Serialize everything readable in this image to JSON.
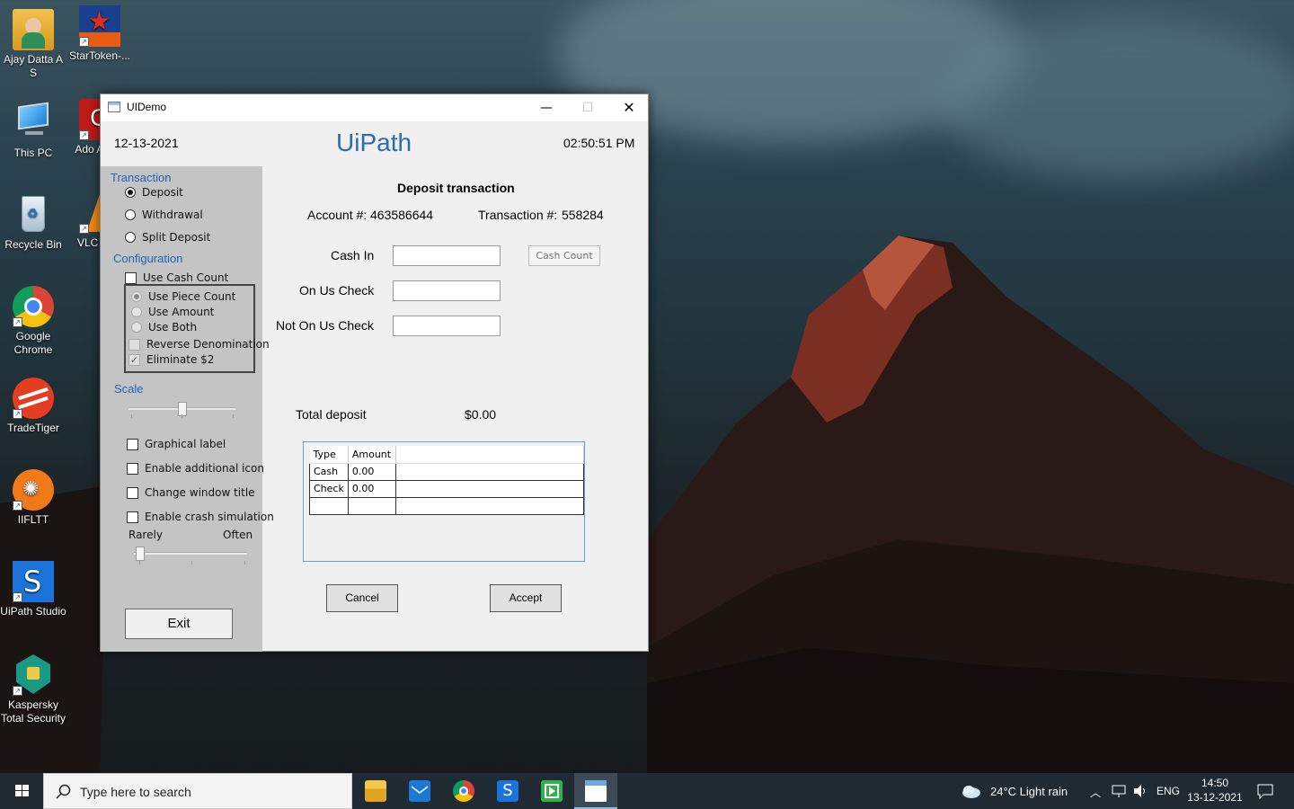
{
  "desktop": {
    "icons": [
      {
        "label": "Ajay Datta A S"
      },
      {
        "label": "StarToken-..."
      },
      {
        "label": "This PC"
      },
      {
        "label": "Ado Acrob"
      },
      {
        "label": "Recycle Bin"
      },
      {
        "label": "VLC r pla"
      },
      {
        "label": "Google Chrome"
      },
      {
        "label": "TradeTiger"
      },
      {
        "label": "IIFLTT"
      },
      {
        "label": "UiPath Studio"
      },
      {
        "label": "Kaspersky Total Security"
      }
    ]
  },
  "window": {
    "title": "UIDemo",
    "controls": {
      "minimize": "—",
      "maximize": "☐",
      "close": "✕"
    },
    "header": {
      "date": "12-13-2021",
      "brand": "UiPath",
      "time": "02:50:51 PM"
    },
    "left": {
      "transaction_label": "Transaction",
      "transaction_options": [
        "Deposit",
        "Withdrawal",
        "Split Deposit"
      ],
      "transaction_selected": "Deposit",
      "configuration_label": "Configuration",
      "use_cash_count": "Use Cash Count",
      "cash_count_options": [
        "Use Piece Count",
        "Use Amount",
        "Use Both"
      ],
      "reverse_denomination": "Reverse Denomination",
      "eliminate_2": "Eliminate $2",
      "eliminate_2_checked": true,
      "scale_label": "Scale",
      "scale_value": 0.5,
      "graphical_label": "Graphical label",
      "enable_additional_icon": "Enable additional icon",
      "change_window_title": "Change window title",
      "enable_crash_simulation": "Enable crash simulation",
      "rarely": "Rarely",
      "often": "Often",
      "crash_value": 0.0,
      "exit": "Exit"
    },
    "main": {
      "title": "Deposit transaction",
      "account_label": "Account #:",
      "account_value": "463586644",
      "transaction_label": "Transaction #:",
      "transaction_value": "558284",
      "cash_in": "Cash In",
      "on_us_check": "On Us Check",
      "not_on_us_check": "Not On Us Check",
      "cash_count_button": "Cash Count",
      "total_deposit_label": "Total deposit",
      "total_deposit_value": "$0.00",
      "grid": {
        "headers": [
          "Type",
          "Amount"
        ],
        "rows": [
          [
            "Cash",
            "0.00"
          ],
          [
            "Check",
            "0.00"
          ],
          [
            "",
            ""
          ]
        ]
      },
      "cancel": "Cancel",
      "accept": "Accept"
    }
  },
  "taskbar": {
    "search_placeholder": "Type here to search",
    "weather": "24°C  Light rain",
    "lang": "ENG",
    "time": "14:50",
    "date": "13-12-2021"
  },
  "colors": {
    "brand_blue": "#2b6cb0",
    "group_label_blue": "#1e63b5",
    "grid_border": "#6e9ad6"
  }
}
